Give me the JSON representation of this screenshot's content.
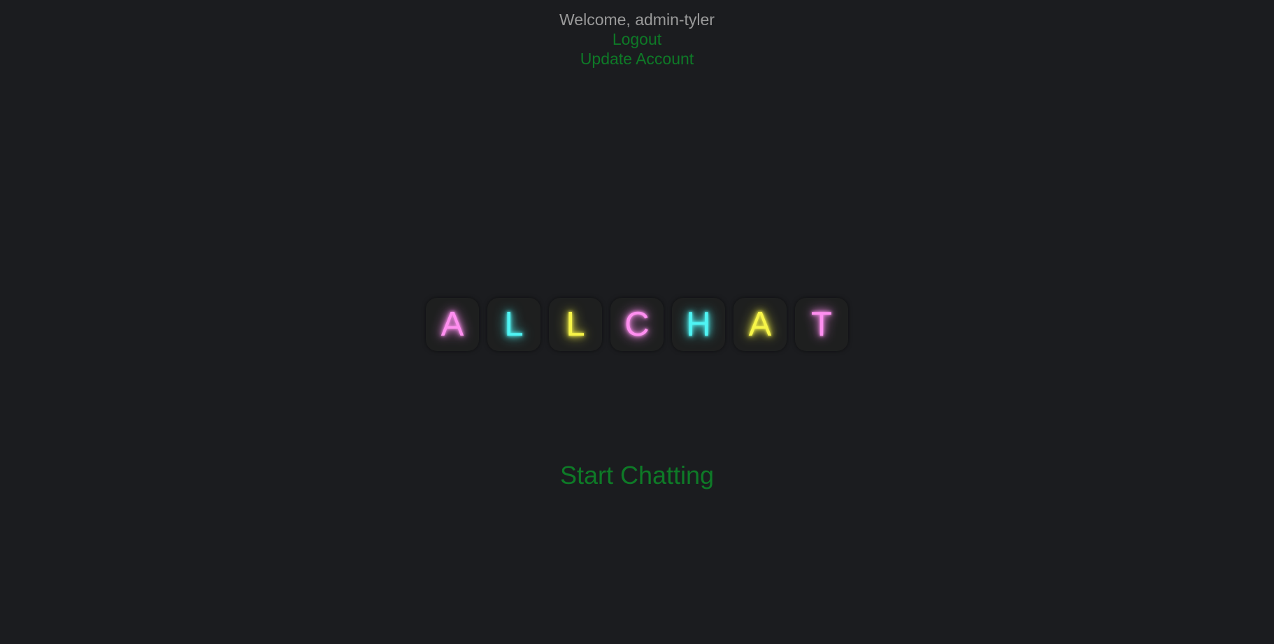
{
  "header": {
    "welcome_text": "Welcome, admin-tyler",
    "logout_label": "Logout",
    "update_account_label": "Update Account"
  },
  "logo": {
    "letters": [
      {
        "char": "A",
        "color": "#ff8ff0"
      },
      {
        "char": "L",
        "color": "#4ff4f4"
      },
      {
        "char": "L",
        "color": "#f7f548"
      },
      {
        "char": "C",
        "color": "#ff8ff0"
      },
      {
        "char": "H",
        "color": "#4ff4f4"
      },
      {
        "char": "A",
        "color": "#f7f548"
      },
      {
        "char": "T",
        "color": "#ff8ff0"
      }
    ]
  },
  "main": {
    "start_label": "Start Chatting"
  },
  "colors": {
    "background": "#1b1c1f",
    "link": "#0e7a27",
    "muted_text": "#9a9a9a"
  }
}
